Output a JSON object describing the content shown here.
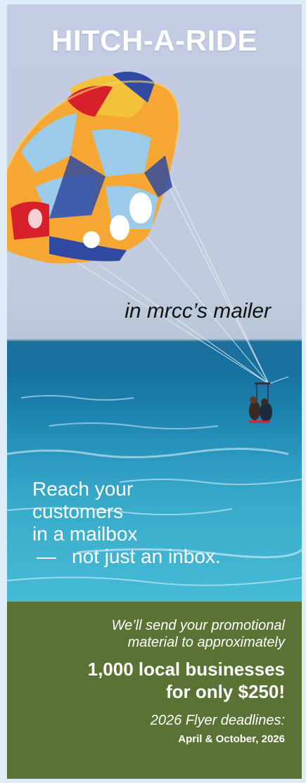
{
  "ad": {
    "headline": "HITCH-A-RIDE",
    "subhead": "in mrcc’s mailer",
    "reach_lines": [
      "Reach your",
      "customers",
      "in a mailbox"
    ],
    "reach_dash": "—",
    "reach_last": "not just an inbox.",
    "intro_lines": [
      "We’ll send your promotional",
      "material to approximately"
    ],
    "offer_lines": [
      "1,000 local businesses",
      "for only $250!"
    ],
    "deadline_label": "2026 Flyer deadlines:",
    "deadline_dates": "April & October, 2026"
  },
  "colors": {
    "sky": "#c2cbe2",
    "sea_deep": "#17709f",
    "sea_light": "#45bad5",
    "info_panel": "#5a7233",
    "page_bg": "#ddecf6"
  },
  "image": {
    "subject": "parasail-photo",
    "parachute_colors": [
      "#f6a632",
      "#f2c33a",
      "#9ccbea",
      "#2f4aa0",
      "#d8202a"
    ]
  }
}
